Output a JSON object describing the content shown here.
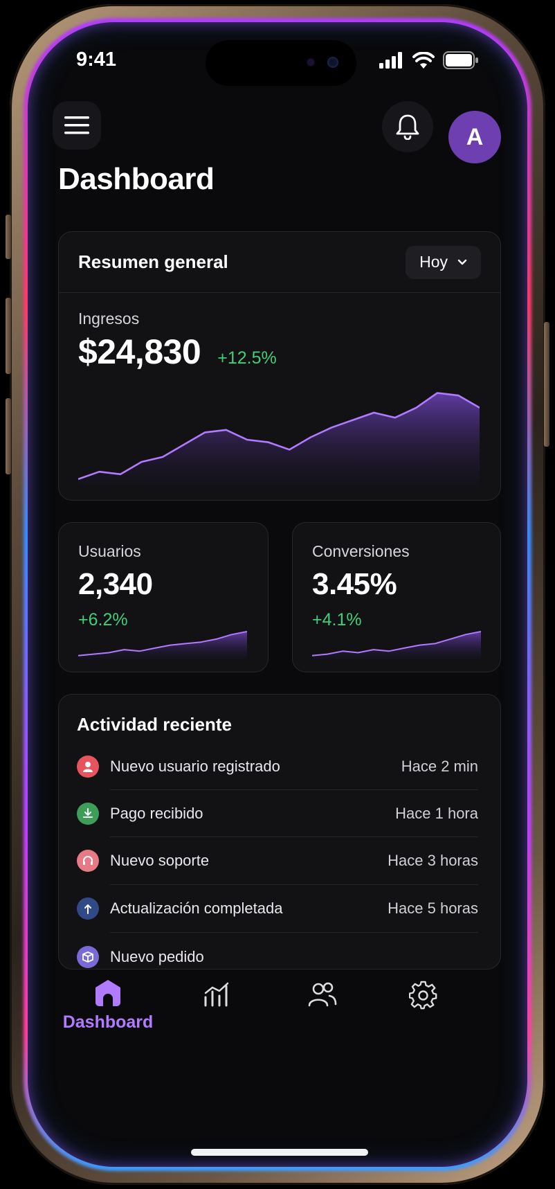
{
  "status_bar": {
    "time": "9:41"
  },
  "header": {
    "avatar_initial": "A",
    "title": "Dashboard"
  },
  "overview": {
    "title": "Resumen general",
    "period": "Hoy",
    "revenue_label": "Ingresos",
    "revenue_value": "$24,830",
    "revenue_change": "+12.5%"
  },
  "stats": [
    {
      "label": "Usuarios",
      "value": "2,340",
      "change": "+6.2%"
    },
    {
      "label": "Conversiones",
      "value": "3.45%",
      "change": "+4.1%"
    }
  ],
  "activity": {
    "title": "Actividad reciente",
    "items": [
      {
        "text": "Nuevo usuario registrado",
        "time": "Hace 2 min",
        "icon": "user-icon",
        "color": "#e8545e"
      },
      {
        "text": "Pago recibido",
        "time": "Hace 1 hora",
        "icon": "download-icon",
        "color": "#3f9d5a"
      },
      {
        "text": "Nuevo soporte",
        "time": "Hace 3 horas",
        "icon": "headset-icon",
        "color": "#e87a86"
      },
      {
        "text": "Actualización completada",
        "time": "Hace 5 horas",
        "icon": "upload-icon",
        "color": "#2f4a86"
      },
      {
        "text": "Nuevo pedido",
        "time": "",
        "icon": "box-icon",
        "color": "#7a6ad8"
      }
    ]
  },
  "tabbar": {
    "items": [
      {
        "label": "Dashboard",
        "icon": "home-icon",
        "active": true
      },
      {
        "label": "",
        "icon": "chart-icon",
        "active": false
      },
      {
        "label": "",
        "icon": "users-icon",
        "active": false
      },
      {
        "label": "",
        "icon": "gear-icon",
        "active": false
      }
    ]
  },
  "colors": {
    "accent": "#b07bff",
    "positive": "#3fcf78",
    "avatar": "#6d3fb0"
  },
  "chart_data": [
    {
      "type": "area",
      "x": [
        1,
        2,
        3,
        4,
        5,
        6,
        7,
        8,
        9,
        10,
        11,
        12,
        13,
        14,
        15,
        16,
        17,
        18,
        19,
        20
      ],
      "series": [
        {
          "values": [
            2,
            5,
            4,
            9,
            11,
            16,
            21,
            22,
            18,
            17,
            14,
            19,
            23,
            26,
            29,
            27,
            31,
            37,
            36,
            31
          ]
        }
      ]
    },
    {
      "type": "area",
      "x": [
        1,
        2,
        3,
        4,
        5,
        6,
        7,
        8,
        9,
        10,
        11,
        12
      ],
      "series": [
        {
          "values": [
            1,
            2,
            3,
            5,
            4,
            6,
            8,
            9,
            10,
            12,
            15,
            17
          ]
        }
      ]
    },
    {
      "type": "area",
      "x": [
        1,
        2,
        3,
        4,
        5,
        6,
        7,
        8,
        9,
        10,
        11,
        12
      ],
      "series": [
        {
          "values": [
            1,
            2,
            4,
            3,
            5,
            4,
            6,
            8,
            9,
            12,
            15,
            17
          ]
        }
      ]
    }
  ]
}
